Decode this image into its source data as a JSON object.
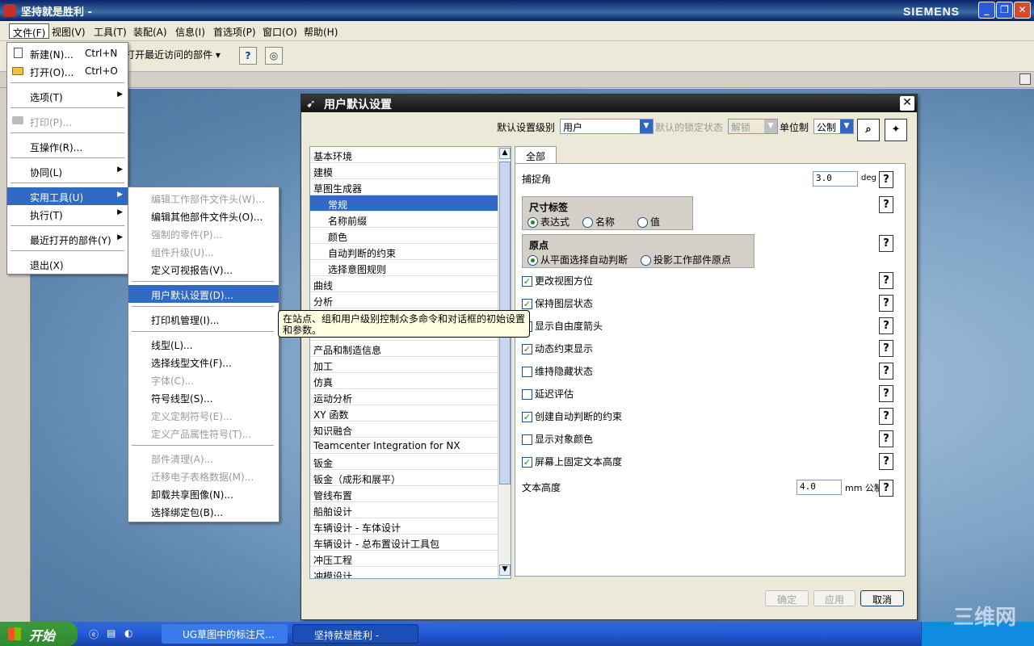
{
  "window": {
    "title": "坚持就是胜利 -",
    "brand": "SIEMENS",
    "minimize": "_",
    "restore": "❐",
    "close": "✕"
  },
  "menubar": [
    "文件(F)",
    "视图(V)",
    "工具(T)",
    "装配(A)",
    "信息(I)",
    "首选项(P)",
    "窗口(O)",
    "帮助(H)"
  ],
  "toolbar": {
    "recent_label": "打开最近访问的部件 ▾",
    "help_glyph": "?"
  },
  "file_menu": {
    "new": {
      "label": "新建(N)...",
      "shortcut": "Ctrl+N"
    },
    "open": {
      "label": "打开(O)...",
      "shortcut": "Ctrl+O"
    },
    "options": "选项(T)",
    "print": "打印(P)...",
    "interop": "互操作(R)...",
    "collab": "协同(L)",
    "utilities": "实用工具(U)",
    "execute": "执行(T)",
    "recent": "最近打开的部件(Y)",
    "exit": "退出(X)"
  },
  "util_menu": [
    "编辑工作部件文件头(W)...",
    "编辑其他部件文件头(O)...",
    "强制的零件(P)...",
    "组件升级(U)...",
    "定义可视报告(V)...",
    "用户默认设置(D)...",
    "打印机管理(I)...",
    "线型(L)...",
    "选择线型文件(F)...",
    "字体(C)...",
    "符号线型(S)...",
    "定义定制符号(E)...",
    "定义产品属性符号(T)...",
    "部件清理(A)...",
    "迁移电子表格数据(M)...",
    "卸载共享图像(N)...",
    "选择绑定包(B)..."
  ],
  "tooltip": "在站点、组和用户级别控制众多命令和对话框的初始设置和参数。",
  "dialog": {
    "title": "用户默认设置",
    "level_label": "默认设置级别",
    "level_value": "用户",
    "lock_label": "默认的锁定状态",
    "lock_value": "解锁",
    "unit_label": "单位制",
    "unit_value": "公制",
    "tree": [
      "基本环境",
      "建模",
      "草图生成器",
      "常规",
      "名称前缀",
      "颜色",
      "自动判断的约束",
      "选择意图规则",
      "曲线",
      "分析",
      "",
      "",
      "产品和制造信息",
      "加工",
      "仿真",
      "运动分析",
      "XY 函数",
      "知识融合",
      "Teamcenter Integration for NX",
      "钣金",
      "钣金（成形和展平）",
      "管线布置",
      "船舶设计",
      "车辆设计 - 车体设计",
      "车辆设计 - 总布置设计工具包",
      "冲压工程",
      "冲模设计"
    ],
    "tab": "全部",
    "snap_label": "捕捉角",
    "snap_value": "3.0",
    "snap_unit": "deg",
    "dim_group": "尺寸标签",
    "dim_opts": [
      "表达式",
      "名称",
      "值"
    ],
    "origin_group": "原点",
    "origin_opts": [
      "从平面选择自动判断",
      "投影工作部件原点"
    ],
    "checks": [
      "更改视图方位",
      "保持图层状态",
      "显示自由度箭头",
      "动态约束显示",
      "维持隐藏状态",
      "延迟评估",
      "创建自动判断的约束",
      "显示对象颜色",
      "屏幕上固定文本高度"
    ],
    "check_states": [
      true,
      true,
      true,
      true,
      false,
      false,
      true,
      false,
      true
    ],
    "text_h_label": "文本高度",
    "text_h_value": "4.0",
    "text_h_unit": "mm 公制",
    "ok": "确定",
    "apply": "应用",
    "cancel": "取消"
  },
  "taskbar": {
    "start": "开始",
    "tasks": [
      "UG草图中的标注尺...",
      "坚持就是胜利 -"
    ],
    "watermark": "三维网"
  }
}
